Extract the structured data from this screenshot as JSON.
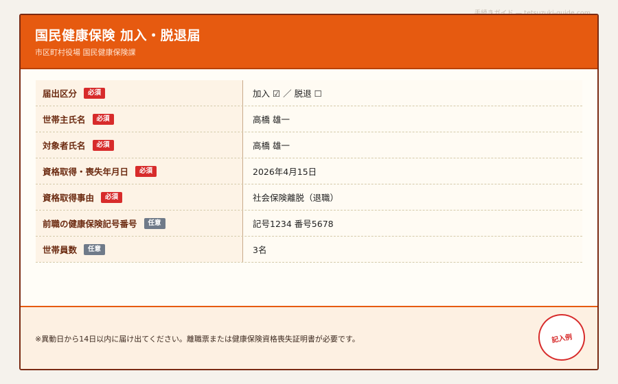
{
  "watermark": "手続きガイド — tetsuzuki-guide.com",
  "header": {
    "title": "国民健康保険 加入・脱退届",
    "subtitle": "市区町村役場 国民健康保険課"
  },
  "form": {
    "rows": [
      {
        "label": "届出区分",
        "badge": "必須",
        "badge_type": "required",
        "value": "加入 ☑ ／ 脱退 ☐"
      },
      {
        "label": "世帯主氏名",
        "badge": "必須",
        "badge_type": "required",
        "value": "高橋 雄一"
      },
      {
        "label": "対象者氏名",
        "badge": "必須",
        "badge_type": "required",
        "value": "高橋 雄一"
      },
      {
        "label": "資格取得・喪失年月日",
        "badge": "必須",
        "badge_type": "required",
        "value": "2026年4月15日"
      },
      {
        "label": "資格取得事由",
        "badge": "必須",
        "badge_type": "required",
        "value": "社会保険離脱（退職）"
      },
      {
        "label": "前職の健康保険記号番号",
        "badge": "任意",
        "badge_type": "optional",
        "value": "記号1234 番号5678"
      },
      {
        "label": "世帯員数",
        "badge": "任意",
        "badge_type": "optional",
        "value": "3名"
      }
    ]
  },
  "footer": {
    "note": "※異動日から14日以内に届け出てください。離職票または健康保険資格喪失証明書が必要です。",
    "stamp": "記入例"
  },
  "colors": {
    "header_bg": "#e65a10",
    "required_badge": "#d72b2b",
    "optional_badge": "#6f7a89",
    "label_text": "#6b2a10",
    "border": "#7a2a12"
  }
}
